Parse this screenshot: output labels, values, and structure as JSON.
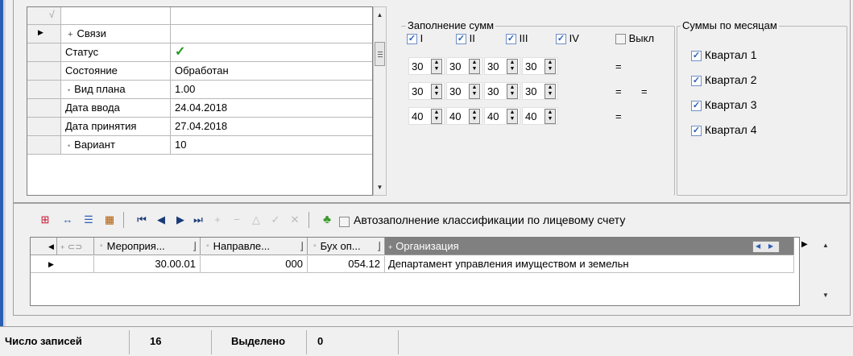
{
  "properties": {
    "rows": [
      {
        "name": "Связи",
        "value": "",
        "expand": "+"
      },
      {
        "name": "Статус",
        "value": "✓"
      },
      {
        "name": "Состояние",
        "value": "Обработан"
      },
      {
        "name": "Вид плана",
        "value": "1.00",
        "bullet": true
      },
      {
        "name": "Дата ввода",
        "value": "24.04.2018"
      },
      {
        "name": "Дата принятия",
        "value": "27.04.2018"
      },
      {
        "name": "Вариант",
        "value": "10",
        "bullet": true
      }
    ]
  },
  "sum_fill": {
    "title": "Заполнение сумм",
    "checks": [
      "I",
      "II",
      "III",
      "IV"
    ],
    "off_label": "Выкл",
    "rows": [
      {
        "values": [
          "30",
          "30",
          "30",
          "30"
        ],
        "eq": [
          "="
        ]
      },
      {
        "values": [
          "30",
          "30",
          "30",
          "30"
        ],
        "eq": [
          "=",
          "="
        ]
      },
      {
        "values": [
          "40",
          "40",
          "40",
          "40"
        ],
        "eq": [
          "="
        ]
      }
    ]
  },
  "monthly": {
    "title": "Суммы по месяцам",
    "quarters": [
      "Квартал 1",
      "Квартал 2",
      "Квартал 3",
      "Квартал 4"
    ]
  },
  "toolbar": {
    "autofill_label": "Автозаполнение классификации по лицевому счету"
  },
  "lower_grid": {
    "headers": [
      "Мероприя...",
      "Направле...",
      "Бух оп...",
      "Организация"
    ],
    "row": [
      "30.00.01",
      "000",
      "054.12",
      "Департамент управления имуществом и земельн"
    ]
  },
  "status": {
    "records_label": "Число записей",
    "records_value": "16",
    "selected_label": "Выделено",
    "selected_value": "0"
  },
  "colors": {
    "accent": "#2a5fb5",
    "check_green": "#1f9a1f",
    "header_dark": "#808080"
  }
}
